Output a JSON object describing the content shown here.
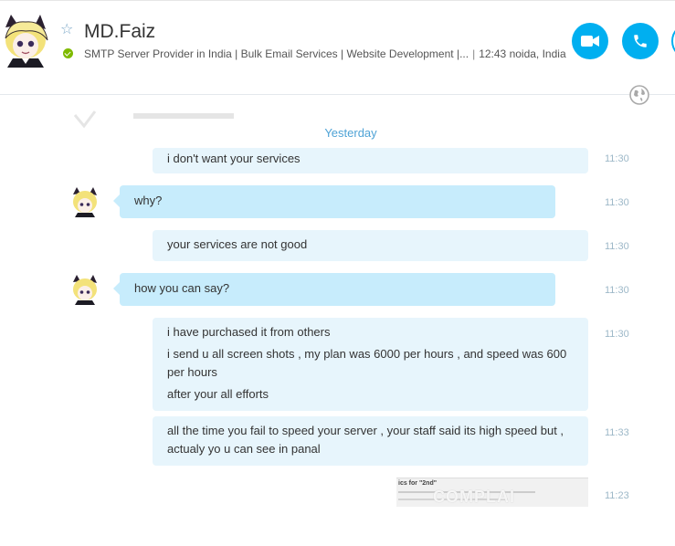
{
  "contact": {
    "name": "MD.Faiz",
    "mood": "SMTP Server Provider in India | Bulk Email Services | Website Development |...",
    "local_time": "12:43 noida, India"
  },
  "chat": {
    "date_separator": "Yesterday",
    "messages": [
      {
        "direction": "out",
        "lines": [
          "i don't want your services"
        ],
        "time": "11:30"
      },
      {
        "direction": "in",
        "lines": [
          "why?"
        ],
        "time": "11:30"
      },
      {
        "direction": "out",
        "lines": [
          "your services are not good"
        ],
        "time": "11:30"
      },
      {
        "direction": "in",
        "lines": [
          "how you can say?"
        ],
        "time": "11:30"
      },
      {
        "direction": "out",
        "lines": [
          "i have purchased it from others",
          "i send u all screen shots , my plan was 6000 per hours , and speed was 600 per hours",
          "after your all efforts"
        ],
        "time": "11:30"
      },
      {
        "direction": "out",
        "lines": [
          "all the time you fail to speed your server , your staff said its high speed but , actualy yo u can see in panal"
        ],
        "time": "11:33"
      }
    ],
    "image_message": {
      "thumb_text": "ics for \"2nd\"",
      "time": "11:23"
    }
  },
  "watermark": "COMPLAI",
  "colors": {
    "accent": "#00aff0",
    "bubble_out": "#e7f5fc",
    "bubble_in": "#c7ecfc",
    "online": "#7fba00"
  },
  "icons": {
    "favorite": "star-outline-icon",
    "video_call": "video-camera-icon",
    "audio_call": "phone-icon",
    "globe": "globe-icon"
  }
}
